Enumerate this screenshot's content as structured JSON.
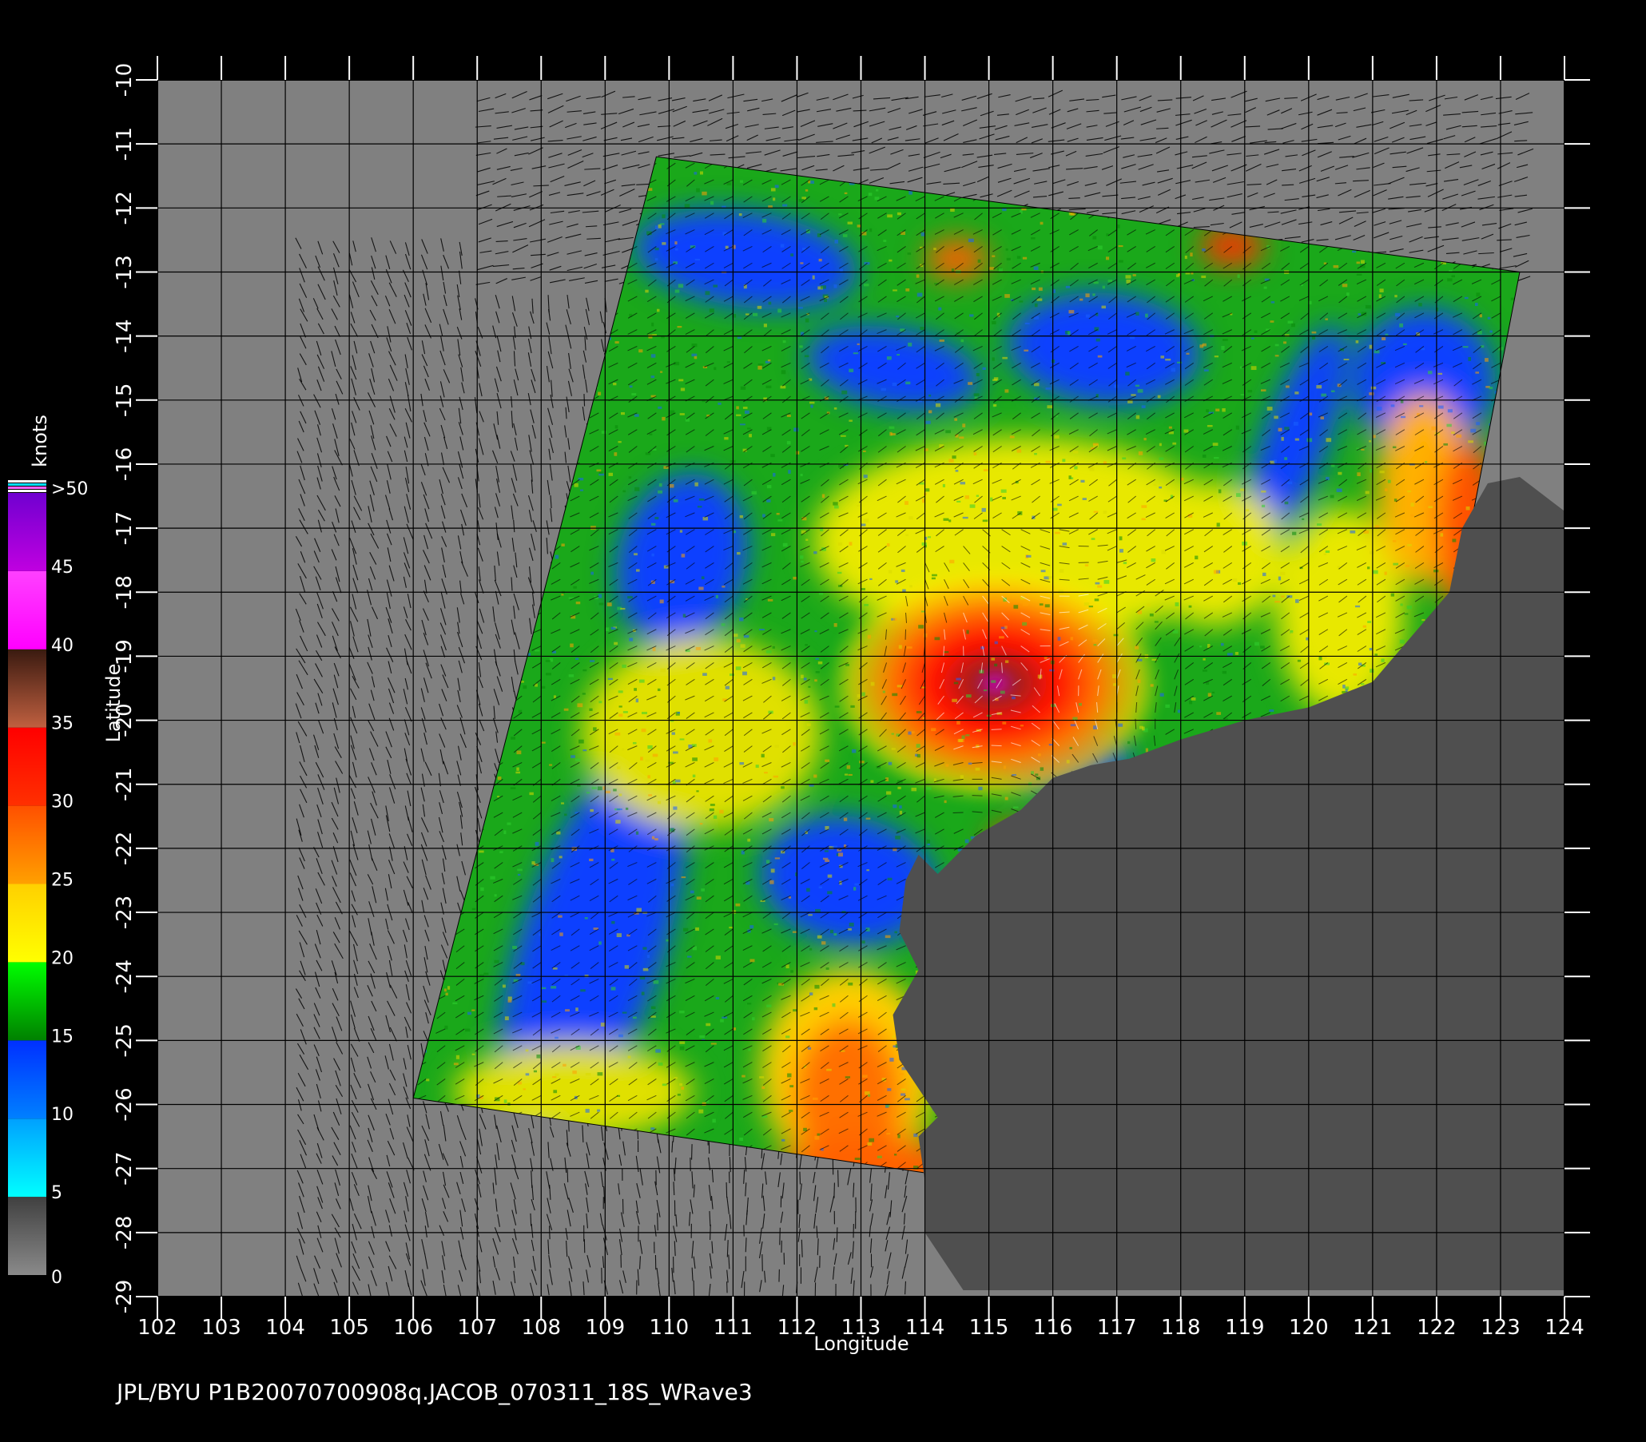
{
  "map": {
    "xlabel": "Longitude",
    "ylabel": "Latitude",
    "lon_range": [
      102,
      124
    ],
    "lat_range": [
      -29,
      -10
    ],
    "lon_ticks": [
      "102",
      "103",
      "104",
      "105",
      "106",
      "107",
      "108",
      "109",
      "110",
      "111",
      "112",
      "113",
      "114",
      "115",
      "116",
      "117",
      "118",
      "119",
      "120",
      "121",
      "122",
      "123",
      "124"
    ],
    "lat_ticks": [
      "-10",
      "-11",
      "-12",
      "-13",
      "-14",
      "-15",
      "-16",
      "-17",
      "-18",
      "-19",
      "-20",
      "-21",
      "-22",
      "-23",
      "-24",
      "-25",
      "-26",
      "-27",
      "-28",
      "-29"
    ],
    "swath_corners_lonlat": [
      [
        109.8,
        -11.2
      ],
      [
        123.3,
        -13.0
      ],
      [
        120.4,
        -28.0
      ],
      [
        106.0,
        -25.9
      ]
    ],
    "storm_center_lonlat": [
      115.6,
      -19.3
    ],
    "colors": {
      "background": "#000000",
      "no_data_ocean": "#808080",
      "land": "#4f4f4f",
      "grid": "#000000",
      "text": "#ffffff"
    }
  },
  "colorbar": {
    "unit_label": "knots",
    "tick_labels": [
      "0",
      "5",
      "10",
      "15",
      "20",
      "25",
      "30",
      "35",
      "40",
      "45",
      ">50"
    ],
    "bands": [
      {
        "from": 0,
        "to": 5,
        "color_top": "#404040",
        "color_bottom": "#8a8a8a"
      },
      {
        "from": 5,
        "to": 10,
        "color_top": "#00a0ff",
        "color_bottom": "#00ffff"
      },
      {
        "from": 10,
        "to": 15,
        "color_top": "#0030ff",
        "color_bottom": "#0080ff"
      },
      {
        "from": 15,
        "to": 20,
        "color_top": "#00ff00",
        "color_bottom": "#008000"
      },
      {
        "from": 20,
        "to": 25,
        "color_top": "#ffd000",
        "color_bottom": "#ffff00"
      },
      {
        "from": 25,
        "to": 30,
        "color_top": "#ff5000",
        "color_bottom": "#ffa000"
      },
      {
        "from": 30,
        "to": 35,
        "color_top": "#ff0000",
        "color_bottom": "#ff3000"
      },
      {
        "from": 35,
        "to": 40,
        "color_top": "#3a1a10",
        "color_bottom": "#c06040"
      },
      {
        "from": 40,
        "to": 45,
        "color_top": "#ff40ff",
        "color_bottom": "#ff00ff"
      },
      {
        "from": 45,
        "to": 50,
        "color_top": "#7000d0",
        "color_bottom": "#c000e0"
      }
    ]
  },
  "caption": "JPL/BYU  P1B20070700908q.JACOB_070311_18S_WRave3"
}
